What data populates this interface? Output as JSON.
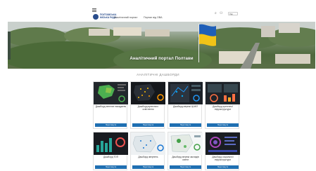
{
  "header": {
    "logo_text": "ПОЛТАВСЬКА МІСЬКА РАДА",
    "nav": [
      "Аналітичний портал",
      "Портал від ОВА"
    ],
    "lang": "Укр"
  },
  "hero": {
    "title": "Аналітичний портал Полтави"
  },
  "section": {
    "title": "АНАЛІТИЧНІ ДАШБОРДИ"
  },
  "cards_row1": [
    {
      "title": "Дашборд зелених насаджень",
      "desc": "",
      "button": "Переглянути",
      "theme": "map-green"
    },
    {
      "title": "Дашборд вуличного освітлення",
      "desc": "",
      "button": "Переглянути",
      "theme": "map-dark"
    },
    {
      "title": "Дашборд мережі ЦНАП",
      "desc": "",
      "button": "Переглянути",
      "theme": "map-blue"
    },
    {
      "title": "Дашборд критичної інфраструктури",
      "desc": "",
      "button": "Переглянути",
      "theme": "map-grey"
    }
  ],
  "cards_row2": [
    {
      "title": "Дашборд ТОП",
      "button": "Переглянути",
      "theme": "dark-bars"
    },
    {
      "title": "Дашборд звернень",
      "button": "Переглянути",
      "theme": "map-light"
    },
    {
      "title": "Дашборд мережі закладів освіти",
      "button": "Переглянути",
      "theme": "map-mixed"
    },
    {
      "title": "Дашборд соціальної інфраструктури",
      "button": "Переглянути",
      "theme": "dark-charts"
    }
  ],
  "colors": {
    "accent_blue": "#1f6fb2",
    "flag_blue": "#1f5fb8",
    "flag_yellow": "#f2c318"
  },
  "icons": [
    "menu-icon",
    "search-icon",
    "user-icon"
  ]
}
